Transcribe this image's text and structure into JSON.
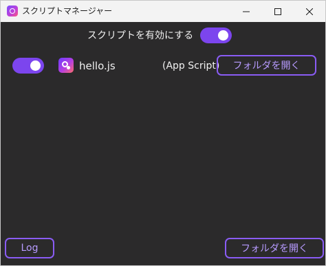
{
  "window": {
    "title": "スクリプトマネージャー"
  },
  "header": {
    "enable_label": "スクリプトを有効にする",
    "enable_toggle_on": true
  },
  "scripts": [
    {
      "enabled": true,
      "name": "hello.js",
      "type": "(App Script)",
      "open_folder_label": "フォルダを開く"
    }
  ],
  "footer": {
    "log_label": "Log",
    "open_folder_label": "フォルダを開く"
  },
  "colors": {
    "accent": "#7c45ee",
    "button_border": "#8a5cf5",
    "button_text": "#b79bff",
    "background": "#2b2a2b",
    "titlebar": "#f3f3f3"
  }
}
